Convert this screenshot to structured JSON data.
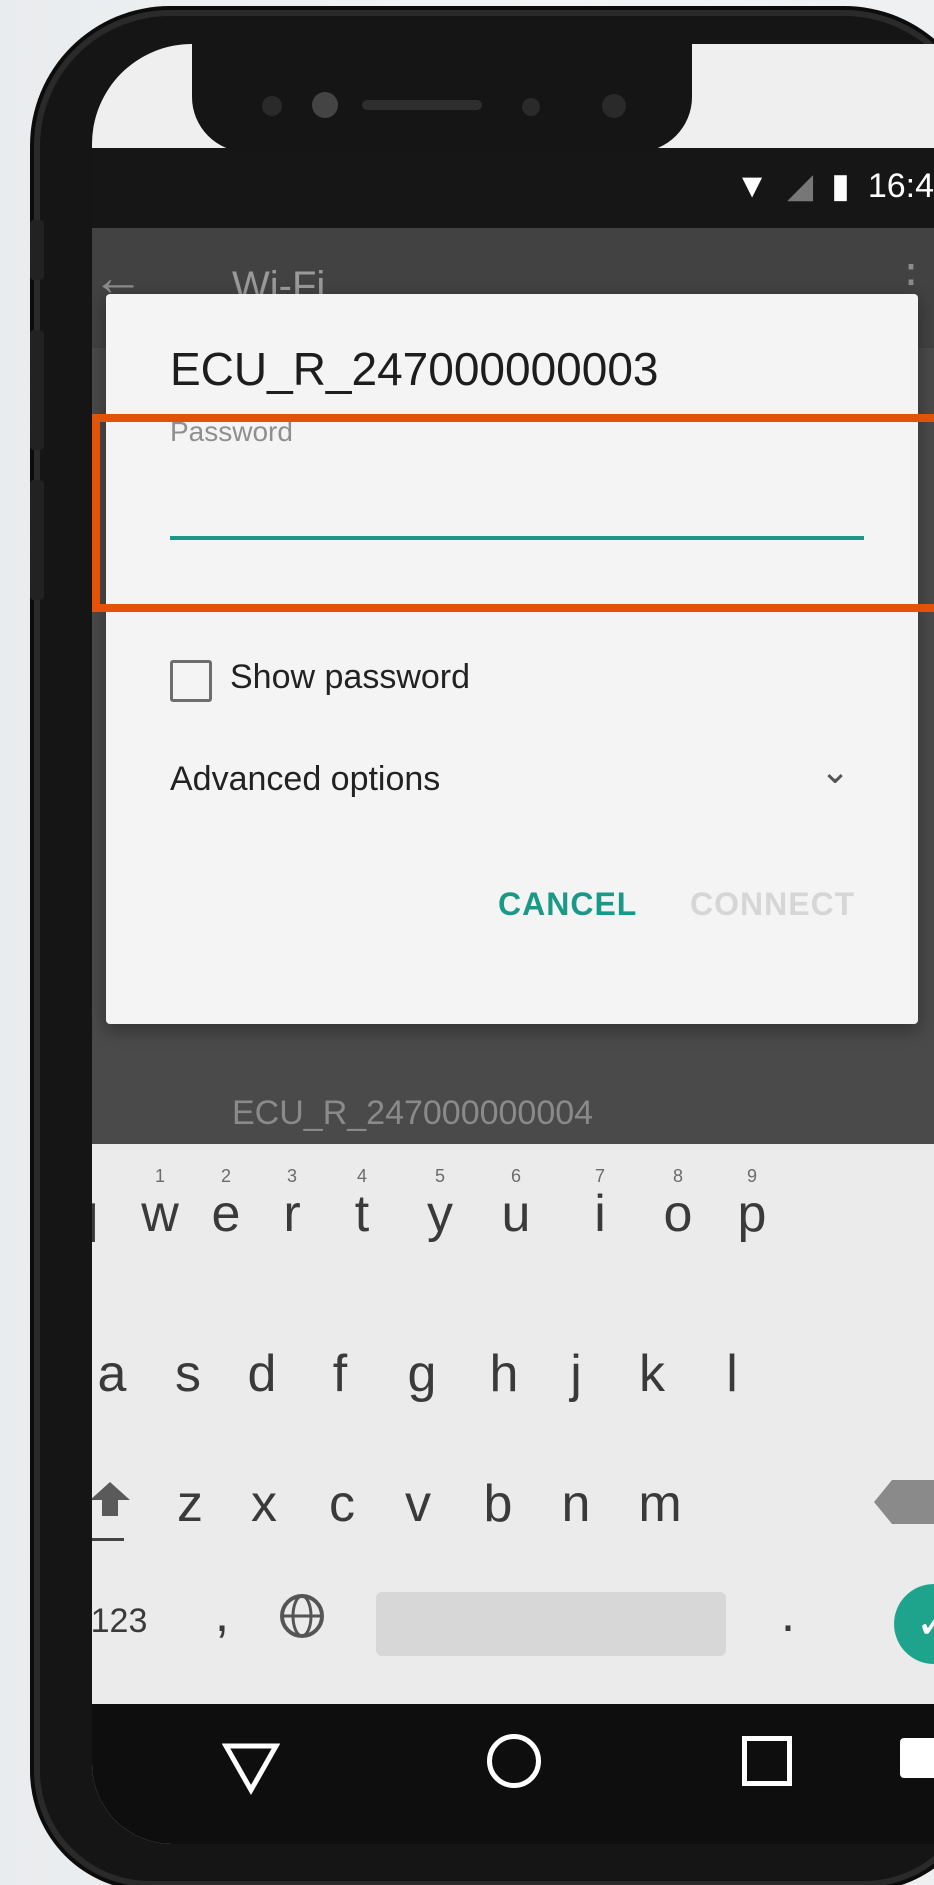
{
  "status_bar": {
    "time": "16:4"
  },
  "app_bar": {
    "title": "Wi-Fi"
  },
  "background_list": {
    "next_network": "ECU_R_247000000004"
  },
  "dialog": {
    "network_name": "ECU_R_247000000003",
    "password_label": "Password",
    "password_value": "",
    "show_password_label": "Show password",
    "show_password_checked": false,
    "advanced_options_label": "Advanced options",
    "cancel_label": "CANCEL",
    "connect_label": "CONNECT"
  },
  "keyboard": {
    "row1": [
      "q",
      "w",
      "e",
      "r",
      "t",
      "y",
      "u",
      "i",
      "o",
      "p"
    ],
    "row1_numbers": [
      "",
      "1",
      "2",
      "3",
      "4",
      "5",
      "6",
      "7",
      "8",
      "9"
    ],
    "row2": [
      "a",
      "s",
      "d",
      "f",
      "g",
      "h",
      "j",
      "k",
      "l"
    ],
    "row3": [
      "z",
      "x",
      "c",
      "v",
      "b",
      "n",
      "m"
    ],
    "symbols_key": "123",
    "comma_key": ",",
    "period_key": "."
  },
  "colors": {
    "accent": "#1a9a86",
    "highlight_box": "#e35207",
    "disabled": "#d6d6d6"
  }
}
